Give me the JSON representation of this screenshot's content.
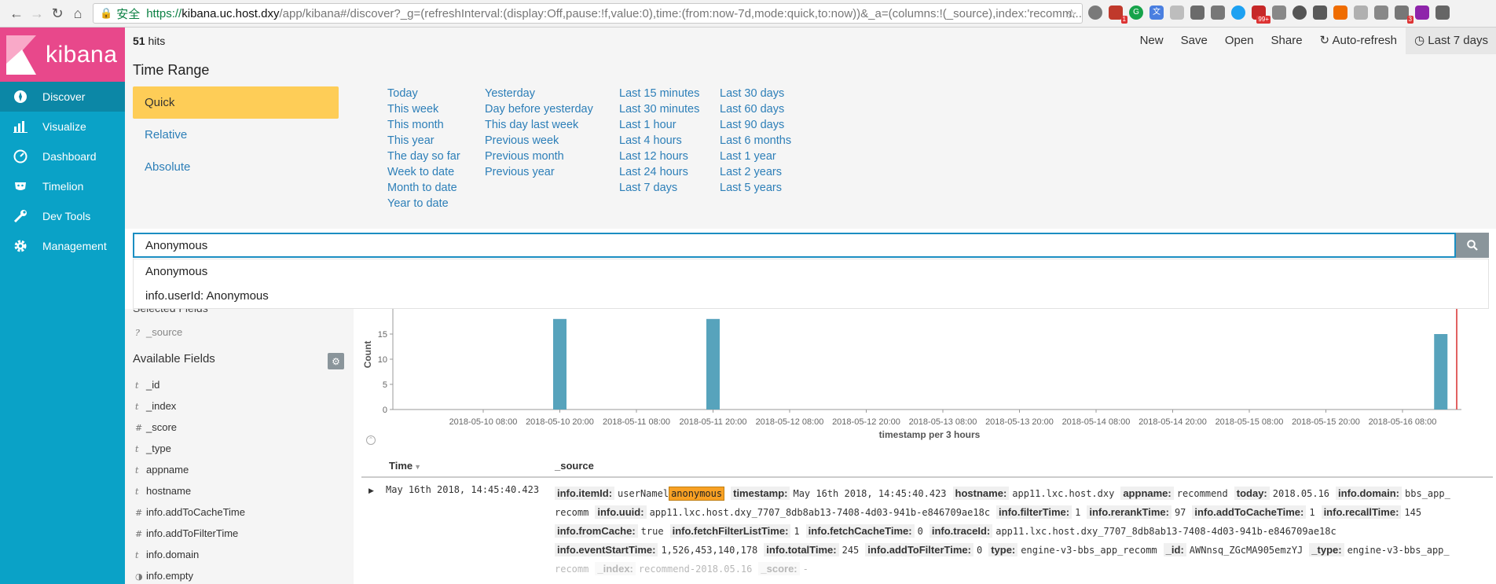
{
  "browser": {
    "secure_label": "安全",
    "url_scheme": "https://",
    "url_host": "kibana.uc.host.dxy",
    "url_rest": "/app/kibana#/discover?_g=(refreshInterval:(display:Off,pause:!f,value:0),time:(from:now-7d,mode:quick,to:now))&_a=(columns:!(_source),index:'recomm...",
    "extension_badges": [
      "1",
      "99+",
      "3"
    ]
  },
  "sidebar": {
    "logo_text": "kibana",
    "items": [
      {
        "label": "Discover",
        "icon": "compass-icon"
      },
      {
        "label": "Visualize",
        "icon": "bar-chart-icon"
      },
      {
        "label": "Dashboard",
        "icon": "dashboard-icon"
      },
      {
        "label": "Timelion",
        "icon": "timelion-icon"
      },
      {
        "label": "Dev Tools",
        "icon": "wrench-icon"
      },
      {
        "label": "Management",
        "icon": "gear-icon"
      }
    ],
    "active_index": 0
  },
  "topbar": {
    "hits_count": "51",
    "hits_label": "hits",
    "menu": [
      "New",
      "Save",
      "Open",
      "Share",
      "Auto-refresh",
      "Last 7 days"
    ]
  },
  "time_range": {
    "title": "Time Range",
    "tabs": [
      "Quick",
      "Relative",
      "Absolute"
    ],
    "active_tab": 0,
    "columns": [
      [
        "Today",
        "This week",
        "This month",
        "This year",
        "The day so far",
        "Week to date",
        "Month to date",
        "Year to date"
      ],
      [
        "Yesterday",
        "Day before yesterday",
        "This day last week",
        "Previous week",
        "Previous month",
        "Previous year"
      ],
      [
        "Last 15 minutes",
        "Last 30 minutes",
        "Last 1 hour",
        "Last 4 hours",
        "Last 12 hours",
        "Last 24 hours",
        "Last 7 days"
      ],
      [
        "Last 30 days",
        "Last 60 days",
        "Last 90 days",
        "Last 6 months",
        "Last 1 year",
        "Last 2 years",
        "Last 5 years"
      ]
    ]
  },
  "search": {
    "value": "Anonymous",
    "suggestions": [
      "Anonymous",
      "info.userId: Anonymous"
    ]
  },
  "fields": {
    "selected_heading": "Selected Fields",
    "selected": [
      {
        "type": "?",
        "name": "_source"
      }
    ],
    "available_heading": "Available Fields",
    "available": [
      {
        "type": "t",
        "name": "_id"
      },
      {
        "type": "t",
        "name": "_index"
      },
      {
        "type": "#",
        "name": "_score"
      },
      {
        "type": "t",
        "name": "_type"
      },
      {
        "type": "t",
        "name": "appname"
      },
      {
        "type": "t",
        "name": "hostname"
      },
      {
        "type": "#",
        "name": "info.addToCacheTime"
      },
      {
        "type": "#",
        "name": "info.addToFilterTime"
      },
      {
        "type": "t",
        "name": "info.domain"
      },
      {
        "type": "◑",
        "name": "info.empty"
      }
    ]
  },
  "chart_data": {
    "type": "bar",
    "title": "",
    "xlabel": "timestamp per 3 hours",
    "ylabel": "Count",
    "ylim": [
      0,
      18
    ],
    "yticks": [
      0,
      5,
      10,
      15
    ],
    "x_ticks": [
      "2018-05-10 08:00",
      "2018-05-10 20:00",
      "2018-05-11 08:00",
      "2018-05-11 20:00",
      "2018-05-12 08:00",
      "2018-05-12 20:00",
      "2018-05-13 08:00",
      "2018-05-13 20:00",
      "2018-05-14 08:00",
      "2018-05-14 20:00",
      "2018-05-15 08:00",
      "2018-05-15 20:00",
      "2018-05-16 08:00"
    ],
    "bars": [
      {
        "x": "2018-05-10 20:00",
        "value": 18
      },
      {
        "x": "2018-05-11 20:00",
        "value": 18
      },
      {
        "x": "2018-05-16 14:00",
        "value": 15
      }
    ],
    "color": "#57a3bc",
    "now_marker_color": "#e26262"
  },
  "table": {
    "col_time": "Time",
    "col_source": "_source",
    "row": {
      "time": "May 16th 2018, 14:45:40.423",
      "lines": [
        [
          [
            "info.itemId:",
            "userNamel",
            "anonymous"
          ],
          [
            "timestamp:",
            "May 16th 2018, 14:45:40.423"
          ],
          [
            "hostname:",
            "app11.lxc.host.dxy"
          ],
          [
            "appname:",
            "recommend"
          ],
          [
            "today:",
            "2018.05.16"
          ],
          [
            "info.domain:",
            "bbs_app_"
          ]
        ],
        [
          [
            "",
            "recomm"
          ],
          [
            "info.uuid:",
            "app11.lxc.host.dxy_7707_8db8ab13-7408-4d03-941b-e846709ae18c"
          ],
          [
            "info.filterTime:",
            "1"
          ],
          [
            "info.rerankTime:",
            "97"
          ],
          [
            "info.addToCacheTime:",
            "1"
          ],
          [
            "info.recallTime:",
            "145"
          ]
        ],
        [
          [
            "info.fromCache:",
            "true"
          ],
          [
            "info.fetchFilterListTime:",
            "1"
          ],
          [
            "info.fetchCacheTime:",
            "0"
          ],
          [
            "info.traceId:",
            "app11.lxc.host.dxy_7707_8db8ab13-7408-4d03-941b-e846709ae18c"
          ]
        ],
        [
          [
            "info.eventStartTime:",
            "1,526,453,140,178"
          ],
          [
            "info.totalTime:",
            "245"
          ],
          [
            "info.addToFilterTime:",
            "0"
          ],
          [
            "type:",
            "engine-v3-bbs_app_recomm"
          ],
          [
            "_id:",
            "AWNnsq_ZGcMA905emzYJ"
          ],
          [
            "_type:",
            "engine-v3-bbs_app_"
          ]
        ],
        [
          [
            "",
            "recomm"
          ],
          [
            "_index:",
            "recommend-2018.05.16"
          ],
          [
            "_score:",
            "-"
          ]
        ]
      ]
    }
  }
}
